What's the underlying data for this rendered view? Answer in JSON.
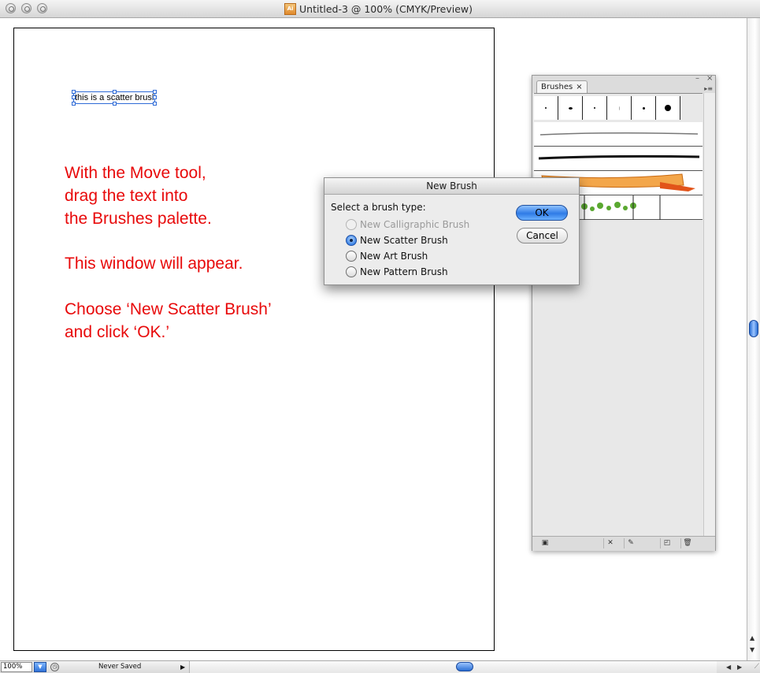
{
  "window": {
    "title": "Untitled-3 @ 100% (CMYK/Preview)",
    "doc_icon_label": "Ai"
  },
  "artboard": {
    "selected_text": "this is a scatter brush",
    "instructions": [
      "With the Move tool,",
      "drag the text into",
      "the Brushes palette.",
      "This window will appear.",
      "Choose ‘New Scatter Brush’",
      "and click ‘OK.’"
    ]
  },
  "brushes_palette": {
    "tab_label": "Brushes",
    "tab_close": "×",
    "minimize_glyph": "–",
    "close_glyph": "×",
    "menu_glyph": "▸≡"
  },
  "dialog": {
    "title": "New Brush",
    "prompt": "Select a brush type:",
    "options": [
      {
        "label": "New Calligraphic Brush",
        "state": "disabled"
      },
      {
        "label": "New Scatter Brush",
        "state": "checked"
      },
      {
        "label": "New Art Brush",
        "state": "unchecked"
      },
      {
        "label": "New Pattern Brush",
        "state": "unchecked"
      }
    ],
    "ok_label": "OK",
    "cancel_label": "Cancel"
  },
  "status_bar": {
    "zoom": "100%",
    "status": "Never Saved"
  },
  "colors": {
    "instruction_text": "#e8090a",
    "selection": "#2f6bd6",
    "aqua_blue": "#2f7be6"
  }
}
